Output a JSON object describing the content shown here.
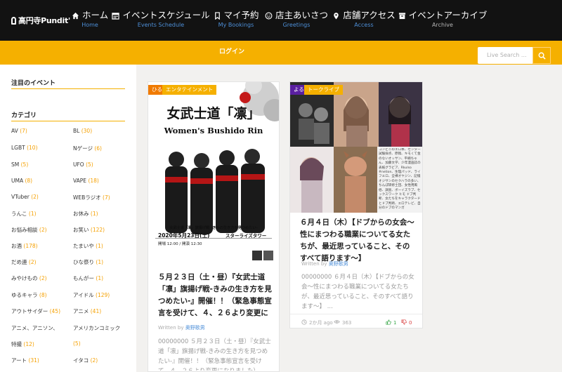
{
  "nav": {
    "logo": "高円寺Pundit'",
    "items": [
      {
        "label": "ホーム",
        "sub": "Home",
        "icon": "home-icon"
      },
      {
        "label": "イベントスケジュール",
        "sub": "Events Schedule",
        "icon": "calendar-icon"
      },
      {
        "label": "マイ予約",
        "sub": "My Bookings",
        "icon": "bookmark-icon"
      },
      {
        "label": "店主あいさつ",
        "sub": "Greetings",
        "icon": "smile-icon"
      },
      {
        "label": "店舗アクセス",
        "sub": "Access",
        "icon": "map-marker-icon"
      },
      {
        "label": "イベントアーカイブ",
        "sub": "Archive",
        "icon": "archive-icon"
      }
    ]
  },
  "bar": {
    "login": "ログイン",
    "search_placeholder": "Live Search ..."
  },
  "sidebar": {
    "featured_title": "注目のイベント",
    "category_title": "カテゴリ",
    "categories": [
      {
        "name": "AV",
        "count": "(7)"
      },
      {
        "name": "BL",
        "count": "(30)"
      },
      {
        "name": "LGBT",
        "count": "(10)"
      },
      {
        "name": "Nゲージ",
        "count": "(6)"
      },
      {
        "name": "SM",
        "count": "(5)"
      },
      {
        "name": "UFO",
        "count": "(5)"
      },
      {
        "name": "UMA",
        "count": "(8)"
      },
      {
        "name": "VAPE",
        "count": "(18)"
      },
      {
        "name": "VTuber",
        "count": "(2)"
      },
      {
        "name": "WEBラジオ",
        "count": "(7)"
      },
      {
        "name": "うんこ",
        "count": "(1)"
      },
      {
        "name": "お休み",
        "count": "(1)"
      },
      {
        "name": "お悩み相談",
        "count": "(2)"
      },
      {
        "name": "お笑い",
        "count": "(122)"
      },
      {
        "name": "お酒",
        "count": "(178)"
      },
      {
        "name": "たまいや",
        "count": "(1)"
      },
      {
        "name": "だめ連",
        "count": "(2)"
      },
      {
        "name": "ひな祭り",
        "count": "(1)"
      },
      {
        "name": "みやけもの",
        "count": "(2)"
      },
      {
        "name": "もんがー",
        "count": "(1)"
      },
      {
        "name": "ゆるキャラ",
        "count": "(8)"
      },
      {
        "name": "アイドル",
        "count": "(129)"
      },
      {
        "name": "アウトサイダー",
        "count": "(45)"
      },
      {
        "name": "アニメ",
        "count": "(41)"
      },
      {
        "name": "アニメ、アニソン、",
        "count": ""
      },
      {
        "name": "アメリカンコミック",
        "count": ""
      },
      {
        "name": "特撮",
        "count": "(12)"
      },
      {
        "name": "",
        "count": "(5)"
      },
      {
        "name": "アート",
        "count": "(31)"
      },
      {
        "name": "イタコ",
        "count": "(2)"
      }
    ]
  },
  "cards": [
    {
      "time_tag": "ひる",
      "genre_tag": "エンタテインメント",
      "poster": {
        "title": "女武士道「凛」",
        "subtitle": "Women's Bushido Rin",
        "caption": "女武士道「凛」旗揚げ戦 -きみの生き方を見つめたい-",
        "date": "2020年5月23日(土)",
        "venue": "スターライズタワー",
        "time": "開場 12:00 / 開演 12:30"
      },
      "title": "５月２３日（土・昼）『女武士道「凛」旗揚げ戦-きみの生き方を見つめたい-』開催！！（緊急事態宣言を受けて、４、２６より変更になりました）",
      "writer_label": "Written by",
      "writer": "奥野歌男",
      "excerpt": "00000000 ５月２３日（土・昼）『女武士道「凛」旗揚げ戦-きみの生き方を見つめたい-』開催！！（緊急事態宣言を受けて、４、２６より変更になりました）"
    },
    {
      "time_tag": "よる",
      "genre_tag": "トークライブ",
      "collage_text": "コンビニのエロ本、センター試験採点、原稿、キモくて金のないオッサン、平綱ちゃん、加藤文学、少年漫画誌の表紙グラビア、Rkulso #netion、生理パッド、ライフエロ、全裸オヤジン、記憶オジサンのセクハラの多い、ちんぽ研修士団、女性用風俗、調査、ボーイズラブ、セックスワーク ヒモ ドブ判断、女たちをキャラクタードとドブ判断、エロテレビ、自分のドブのマンガ",
      "title": "６月４日（木）【ドブからの女会〜性にまつわる職業についてる女たちが、最近思っていること、そのすべて語ります〜】",
      "writer_label": "Written by",
      "writer": "奥野歌男",
      "excerpt": "00000000 ６月４日（木）【ドブからの女会〜性にまつわる職業についてる女たちが、最近思っていること、そのすべて語ります〜】 ...",
      "time_ago": "2か月 ago",
      "views": "363",
      "likes": "1",
      "dislikes": "0"
    }
  ],
  "colors": {
    "accent": "#f5b000",
    "nav_bg": "#121212",
    "tag_orange": "#f07a00",
    "tag_purple": "#5a1fa0",
    "link_blue": "#4d8fd8"
  }
}
